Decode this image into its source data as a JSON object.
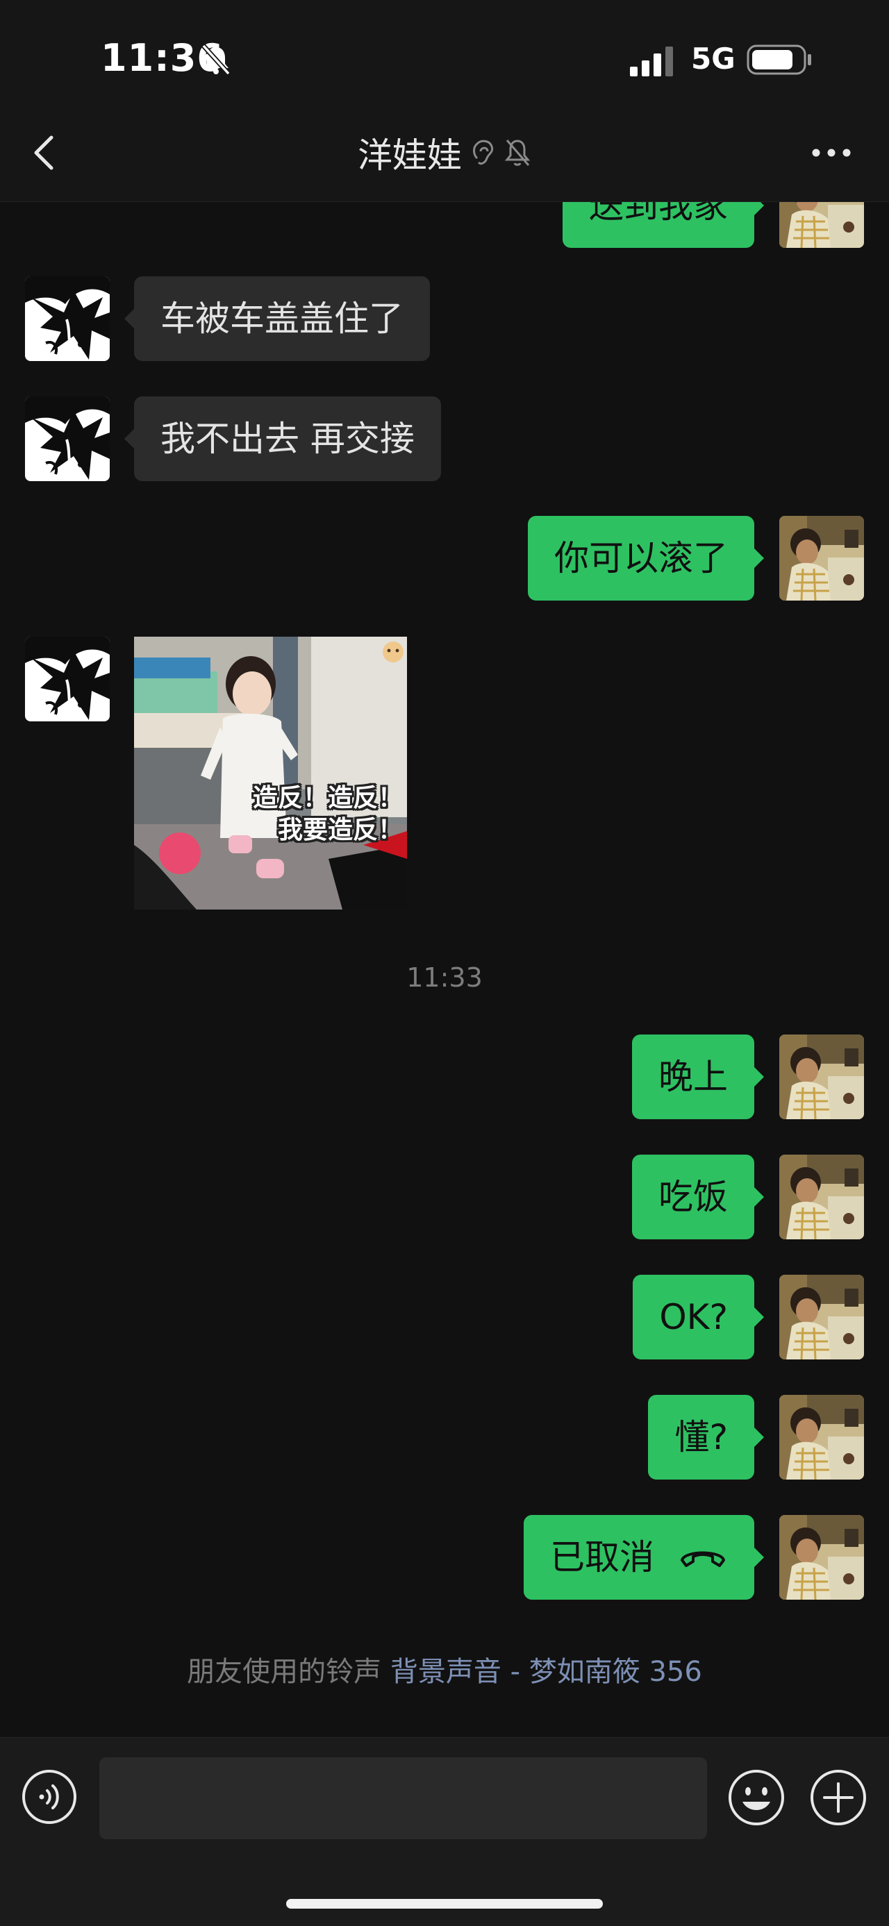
{
  "status_bar": {
    "time": "11:36",
    "network": "5G",
    "icons": [
      "bell-muted-icon",
      "cellular-signal-icon",
      "battery-icon"
    ]
  },
  "nav": {
    "title": "洋娃娃",
    "icons": [
      "back-chevron-icon",
      "ear-icon",
      "bell-muted-icon",
      "more-dots-icon"
    ]
  },
  "messages": [
    {
      "side": "out",
      "text": "送到我家",
      "partial": true
    },
    {
      "side": "in",
      "text": "车被车盖盖住了"
    },
    {
      "side": "in",
      "text": "我不出去 再交接"
    },
    {
      "side": "out",
      "text": "你可以滚了"
    },
    {
      "side": "in",
      "type": "sticker",
      "caption": [
        "造反！造反！",
        "我要造反！"
      ]
    },
    {
      "type": "timestamp",
      "text": "11:33"
    },
    {
      "side": "out",
      "text": "晚上"
    },
    {
      "side": "out",
      "text": "吃饭"
    },
    {
      "side": "out",
      "text": "OK?"
    },
    {
      "side": "out",
      "text": "懂?"
    },
    {
      "side": "out",
      "type": "call",
      "text": "已取消",
      "icon": "phone-hangup-icon"
    }
  ],
  "ringtone": {
    "label": "朋友使用的铃声",
    "song": "背景声音 - 梦如南筱 356"
  },
  "input_bar": {
    "placeholder": "",
    "icons": [
      "voice-icon",
      "emoji-icon",
      "plus-icon"
    ]
  },
  "colors": {
    "background": "#111111",
    "bubble_out": "#2ec162",
    "bubble_in": "#2c2c2c",
    "link": "#7d90b5"
  }
}
